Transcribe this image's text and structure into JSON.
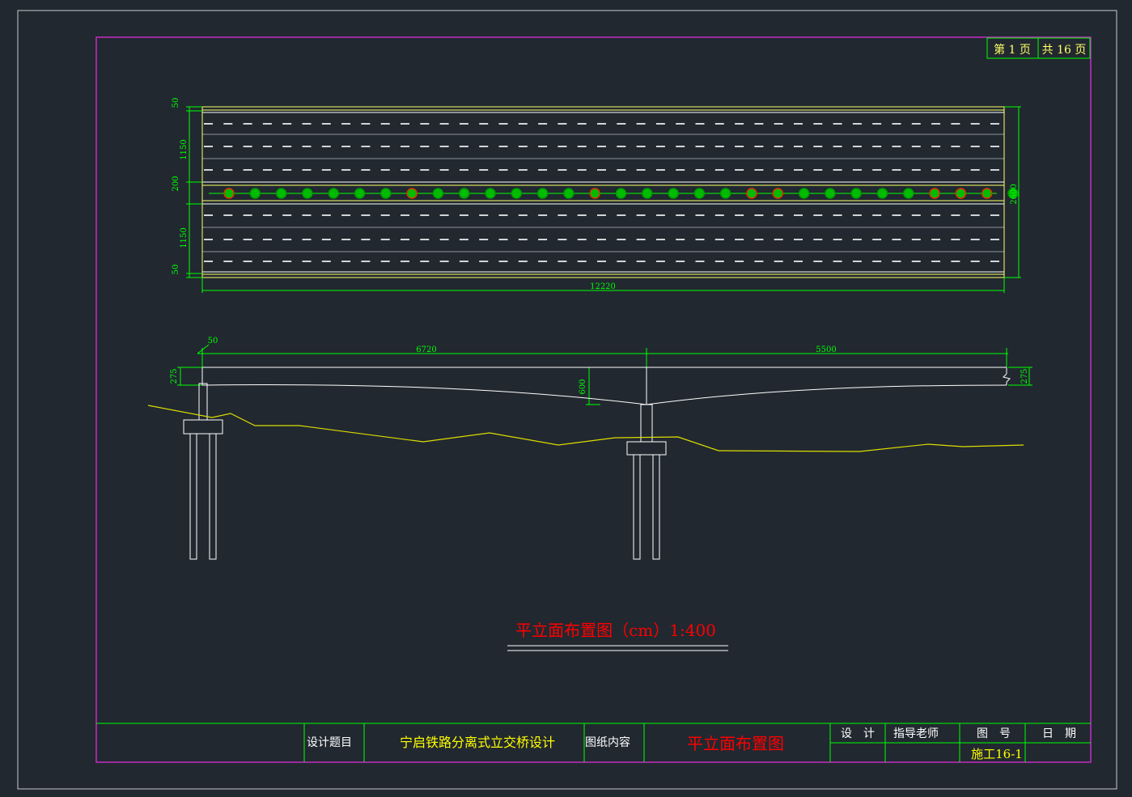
{
  "colors": {
    "background": "#212830",
    "outer_frame": "#c8ccd0",
    "inner_frame": "#c42cc4",
    "dimension": "#00ff00",
    "ground_line": "#ffff00",
    "structure": "#ffffff",
    "deck_edge": "#ffff66",
    "title_red": "#ff0000",
    "tree_green": "#00cc00",
    "tree_red": "#dd3300",
    "label_white": "#ffffff",
    "label_yellow": "#ffff00"
  },
  "page_box": {
    "page_label": "第 1 页",
    "total_label": "共 16 页"
  },
  "plan": {
    "dims_left": [
      "50",
      "1150",
      "200",
      "1150",
      "50"
    ],
    "dim_right": "2600",
    "dim_bottom": "12220"
  },
  "elevation": {
    "dim_top_small": "50",
    "dim_span_left": "6720",
    "dim_span_right": "5500",
    "dim_height_left": "275",
    "dim_height_right": "275",
    "dim_haunch": "600"
  },
  "drawing_title": "平立面布置图（cm）1:400",
  "title_block": {
    "design_topic_label": "设计题目",
    "design_topic_value": "宁启铁路分离式立交桥设计",
    "drawing_content_label": "图纸内容",
    "drawing_content_value": "平立面布置图",
    "designer_label": "设　计",
    "advisor_label": "指导老师",
    "drawing_no_label": "图　号",
    "drawing_no_value": "施工16-1",
    "date_label": "日　期"
  }
}
